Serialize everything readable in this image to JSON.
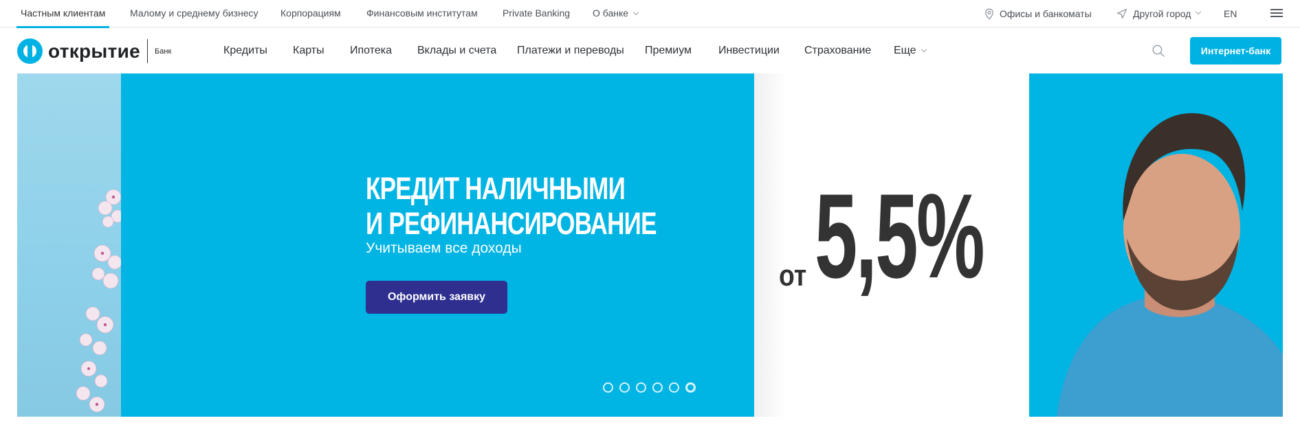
{
  "segments": [
    {
      "label": "Частным клиентам",
      "active": true
    },
    {
      "label": "Малому и среднему бизнесу"
    },
    {
      "label": "Корпорациям"
    },
    {
      "label": "Финансовым институтам"
    },
    {
      "label": "Private Banking"
    },
    {
      "label": "О банке"
    }
  ],
  "topbar_right": {
    "offices": "Офисы и банкоматы",
    "city": "Другой город",
    "lang": "EN"
  },
  "logo": {
    "name": "открытие",
    "sub": "Банк"
  },
  "nav": [
    {
      "label": "Кредиты"
    },
    {
      "label": "Карты"
    },
    {
      "label": "Ипотека"
    },
    {
      "label": "Вклады и счета"
    },
    {
      "label": "Платежи и переводы"
    },
    {
      "label": "Премиум"
    },
    {
      "label": "Инвестиции"
    },
    {
      "label": "Страхование"
    },
    {
      "label": "Еще"
    }
  ],
  "internet_bank_label": "Интернет-банк",
  "hero": {
    "title_line1": "КРЕДИТ НАЛИЧНЫМИ",
    "title_line2": "И РЕФИНАНСИРОВАНИЕ",
    "subtitle": "Учитываем все доходы",
    "button": "Оформить заявку",
    "rate_prefix": "от",
    "rate_value": "5,5%",
    "slides_total": 6,
    "slide_active": 6
  },
  "colors": {
    "brand": "#00b2e3",
    "button_dark": "#2e2f8f",
    "text_dark": "#333333"
  }
}
